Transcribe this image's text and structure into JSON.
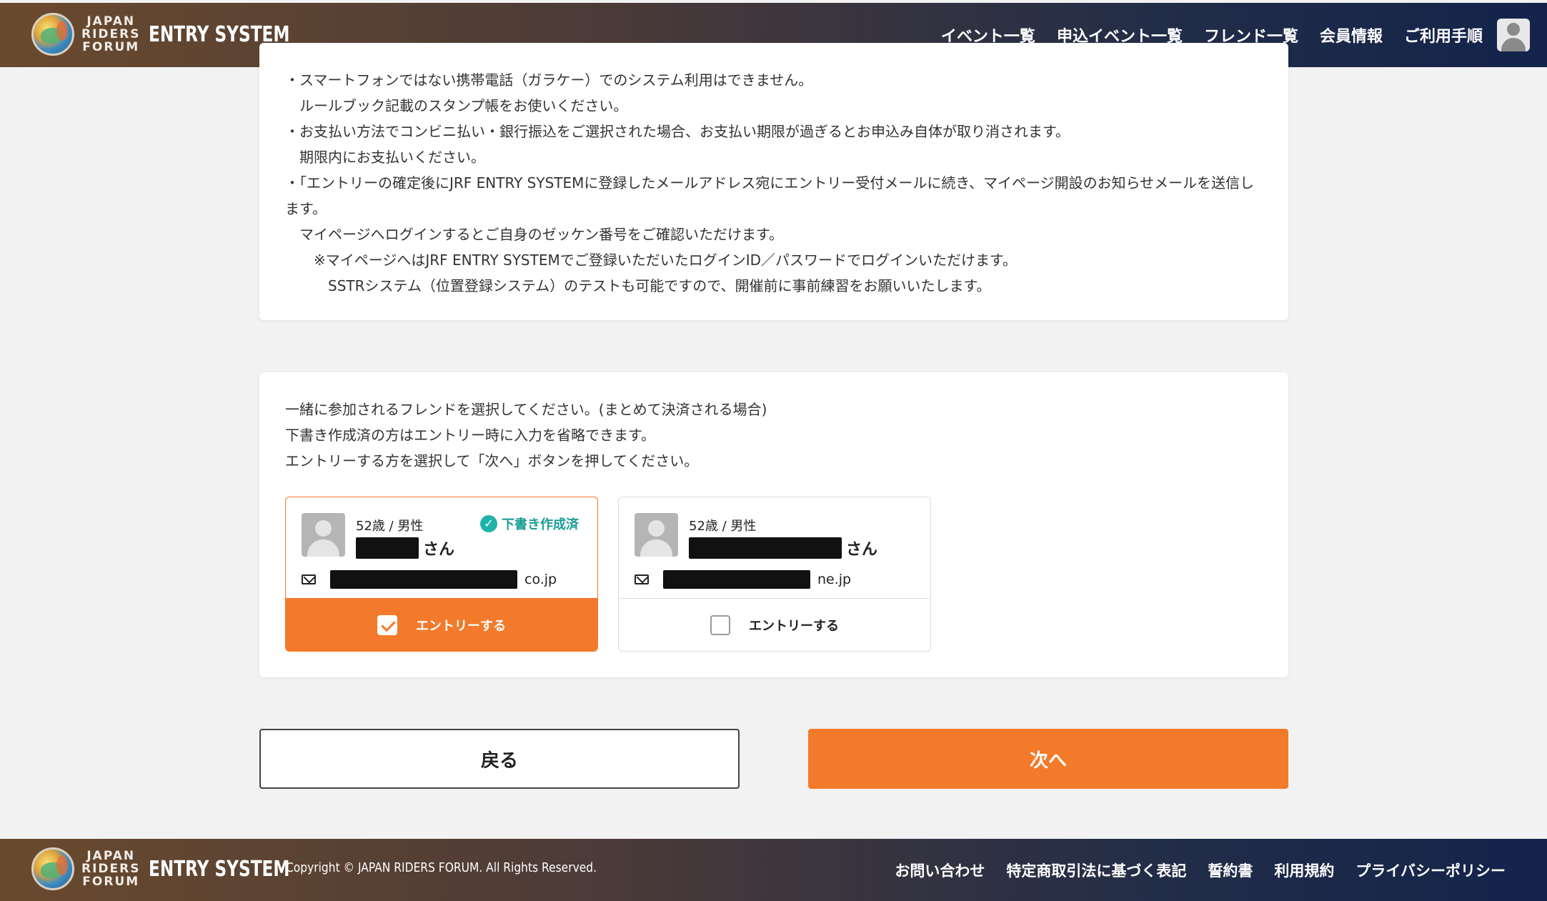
{
  "header": {
    "logo_lines": [
      "JAPAN",
      "RIDERS",
      "FORUM"
    ],
    "system_name": "ENTRY SYSTEM",
    "nav": [
      {
        "label": "イベント一覧"
      },
      {
        "label": "申込イベント一覧"
      },
      {
        "label": "フレンド一覧"
      },
      {
        "label": "会員情報"
      },
      {
        "label": "ご利用手順"
      }
    ]
  },
  "notes": {
    "lines": [
      "・スマートフォンではない携帯電話（ガラケー）でのシステム利用はできません。",
      "　ルールブック記載のスタンプ帳をお使いください。",
      "・お支払い方法でコンビニ払い・銀行振込をご選択された場合、お支払い期限が過ぎるとお申込み自体が取り消されます。",
      "　期限内にお支払いください。",
      "・「エントリーの確定後にJRF ENTRY SYSTEMに登録したメールアドレス宛にエントリー受付メールに続き、マイページ開設のお知らせメールを送信します。",
      "　マイページへログインするとご自身のゼッケン番号をご確認いただけます。",
      "　　※マイページへはJRF ENTRY SYSTEMでご登録いただいたログインID／パスワードでログインいただけます。",
      "　　　SSTRシステム（位置登録システム）のテストも可能ですので、開催前に事前練習をお願いいたします。"
    ]
  },
  "friends_section": {
    "intro": [
      "一緒に参加されるフレンドを選択してください。(まとめて決済される場合)",
      "下書き作成済の方はエントリー時に入力を省略できます。",
      "エントリーする方を選択して「次へ」ボタンを押してください。"
    ],
    "friends": [
      {
        "meta": "52歳 / 男性",
        "honorific": "さん",
        "email_suffix": "co.jp",
        "draft_badge": "下書き作成済",
        "entry_label": "エントリーする",
        "selected": true
      },
      {
        "meta": "52歳 / 男性",
        "honorific": "さん",
        "email_suffix": "ne.jp",
        "draft_badge": "",
        "entry_label": "エントリーする",
        "selected": false
      }
    ]
  },
  "actions": {
    "back_label": "戻る",
    "next_label": "次へ"
  },
  "footer": {
    "logo_lines": [
      "JAPAN",
      "RIDERS",
      "FORUM"
    ],
    "system_name": "ENTRY SYSTEM",
    "copyright": "Copyright © JAPAN RIDERS FORUM. All Rights Reserved.",
    "links": [
      {
        "label": "お問い合わせ"
      },
      {
        "label": "特定商取引法に基づく表記"
      },
      {
        "label": "誓約書"
      },
      {
        "label": "利用規約"
      },
      {
        "label": "プライバシーポリシー"
      }
    ]
  },
  "colors": {
    "accent": "#f37a2a",
    "draft": "#1a9e96"
  }
}
